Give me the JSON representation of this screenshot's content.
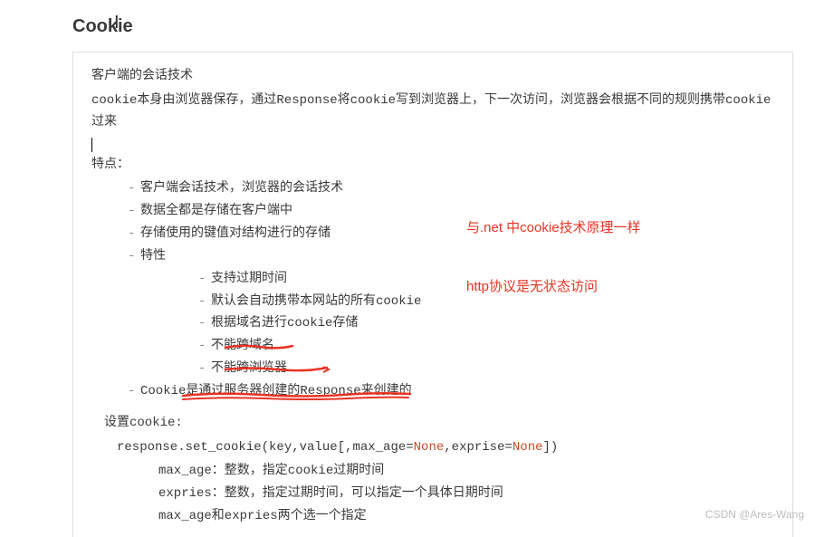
{
  "title": "Cookie",
  "intro_lines": [
    "客户端的会话技术",
    "cookie本身由浏览器保存，通过Response将cookie写到浏览器上，下一次访问，浏览器会根据不同的规则携带cookie过来"
  ],
  "features_label": "特点：",
  "features": [
    "客户端会话技术，浏览器的会话技术",
    "数据全都是存储在客户端中",
    "存储使用的键值对结构进行的存储",
    "特性"
  ],
  "properties": [
    "支持过期时间",
    "默认会自动携带本网站的所有cookie",
    "根据域名进行cookie存储",
    "不能跨域名",
    "不能跨浏览器"
  ],
  "response_line": "Cookie是通过服务器创建的Response来创建的",
  "set_cookie_label": "设置cookie:",
  "code": {
    "fn": "response.set_cookie(key,value[,max_age=",
    "none1": "None",
    "mid": ",exprise=",
    "none2": "None",
    "end": "])"
  },
  "params": [
    "max_age：整数，指定cookie过期时间",
    "expries：整数，指定过期时间，可以指定一个具体日期时间",
    "max_age和expries两个选一个指定"
  ],
  "annotations": {
    "a1": "与.net 中cookie技术原理一样",
    "a2": "http协议是无状态访问"
  },
  "watermark": "CSDN @Ares-Wang"
}
